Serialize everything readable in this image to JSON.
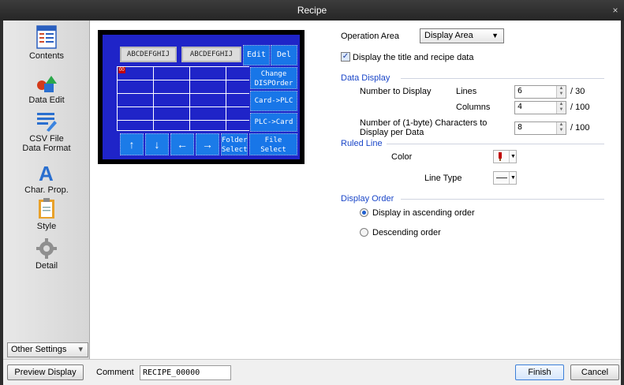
{
  "window": {
    "title": "Recipe",
    "close": "×"
  },
  "sidebar": {
    "items": [
      {
        "label": "Contents",
        "icon": "contents-icon"
      },
      {
        "label": "Data Edit",
        "icon": "data-edit-icon"
      },
      {
        "label": "CSV File\nData Format",
        "icon": "csv-format-icon"
      },
      {
        "label": "Char. Prop.",
        "icon": "char-prop-icon"
      },
      {
        "label": "Style",
        "icon": "style-icon"
      },
      {
        "label": "Detail",
        "icon": "detail-icon"
      }
    ],
    "other_settings": "Other Settings",
    "other_settings_arrow": "▾"
  },
  "preview": {
    "header_1": "ABCDEFGHIJ",
    "header_2": "ABCDEFGHIJ",
    "edit": "Edit",
    "del": "Del",
    "change_disp_order": "Change DISPOrder",
    "card_to_plc": "Card->PLC",
    "plc_to_card": "PLC->Card",
    "folder_select": "Folder Select",
    "file_select": "File Select",
    "arrow_up": "↑",
    "arrow_down": "↓",
    "arrow_left": "←",
    "arrow_right": "→",
    "cell_marker": "00"
  },
  "form": {
    "operation_area_label": "Operation Area",
    "operation_area_value": "Display Area",
    "display_title_checkbox": "Display the title and recipe data",
    "display_title_checked": true,
    "data_display_section": "Data Display",
    "number_to_display_label": "Number to Display",
    "lines_label": "Lines",
    "lines_value": "6",
    "lines_max": "/ 30",
    "columns_label": "Columns",
    "columns_value": "4",
    "columns_max": "/ 100",
    "chars_label": "Number of (1-byte) Characters to Display per Data",
    "chars_value": "8",
    "chars_max": "/ 100",
    "ruled_line_section": "Ruled Line",
    "color_label": "Color",
    "line_type_label": "Line Type",
    "display_order_section": "Display Order",
    "ascending_label": "Display in ascending order",
    "descending_label": "Descending order",
    "ascending_selected": true
  },
  "bottom": {
    "preview_display": "Preview Display",
    "comment_label": "Comment",
    "comment_value": "RECIPE_00000",
    "finish": "Finish",
    "cancel": "Cancel"
  },
  "colors": {
    "accent": "#1a46c8",
    "screen_bg": "#1f24c8",
    "button_blue": "#1876e8",
    "red_marker": "#c00000"
  }
}
